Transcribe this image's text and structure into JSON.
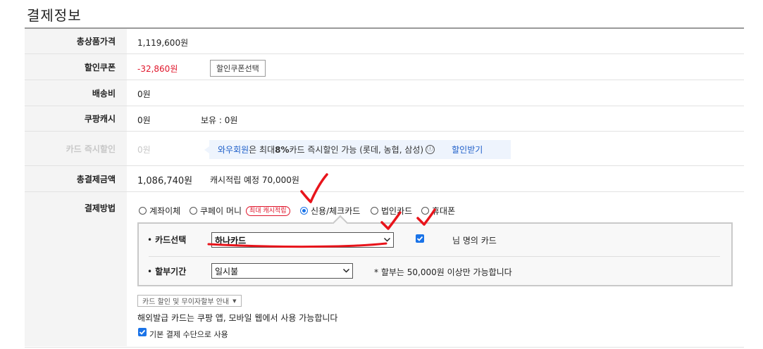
{
  "page": {
    "title": "결제정보"
  },
  "rows": {
    "total_price": {
      "label": "총상품가격",
      "value": "1,119,600원"
    },
    "coupon": {
      "label": "할인쿠폰",
      "value": "-32,860원",
      "button": "할인쿠폰선택"
    },
    "shipping": {
      "label": "배송비",
      "value": "0원"
    },
    "cash": {
      "label": "쿠팡캐시",
      "value": "0원",
      "owned": "보유 : 0원"
    },
    "card_discount": {
      "label": "카드 즉시할인",
      "value": "0원",
      "promo_highlight": "와우회원",
      "promo_mid": "은 최대 ",
      "promo_percent": "8%",
      "promo_rest": " 카드 즉시할인 가능 (롯데, 농협, 삼성)",
      "info_icon": "ⓘ",
      "promo_link": "할인받기"
    },
    "total_payment": {
      "label": "총결제금액",
      "value": "1,086,740원",
      "cash_reward": "캐시적립 예정 70,000원"
    },
    "payment_method": {
      "label": "결제방법",
      "options": [
        {
          "label": "계좌이체",
          "selected": false
        },
        {
          "label": "쿠페이 머니",
          "selected": false,
          "badge": "최대 캐시적립"
        },
        {
          "label": "신용/체크카드",
          "selected": true
        },
        {
          "label": "법인카드",
          "selected": false
        },
        {
          "label": "휴대폰",
          "selected": false
        }
      ],
      "card_select_label": "카드선택",
      "card_select_value": "하나카드",
      "own_card_checked": true,
      "own_card_label": "님 명의 카드",
      "installment_label": "할부기간",
      "installment_value": "일시불",
      "installment_note": "* 할부는 50,000원 이상만 가능합니다",
      "bullet": "•",
      "guide_dropdown": "카드 할인 및 무이자할부 안내",
      "guide_caret": "▼",
      "overseas_note": "해외발급 카드는 쿠팡 앱, 모바일 웹에서 사용 가능합니다",
      "default_checked": true,
      "default_label": "기본 결제 수단으로 사용"
    }
  },
  "colors": {
    "accent_blue": "#1a73e8",
    "price_red": "#e0162b",
    "annotation_red": "#e8141b"
  },
  "icons": {
    "select_caret": "chevron-down-icon",
    "checkmark": "checkmark-icon",
    "info": "info-icon"
  }
}
